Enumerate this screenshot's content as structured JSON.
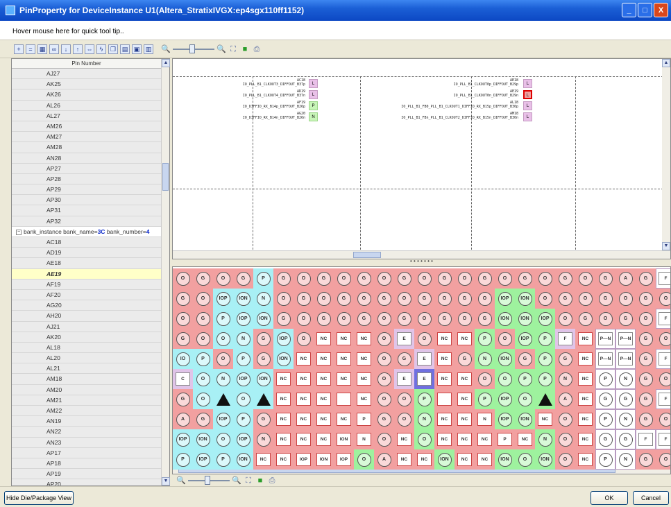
{
  "window": {
    "title": "PinProperty for DeviceInstance U1(Altera_StratixIVGX:ep4sgx110ff1152)",
    "minimize_glyph": "_",
    "maximize_glyph": "□",
    "close_glyph": "X"
  },
  "tooltip_hint": "Hover mouse here for quick tool tip..",
  "toolbar": {
    "icons": [
      "tb-icon-1",
      "tb-icon-2",
      "grid-icon",
      "binoculars-icon",
      "sort-az-icon",
      "sort-za-icon",
      "swap-icon",
      "lightning-icon",
      "copy-icon",
      "paste-icon",
      "export-icon",
      "layout-icon"
    ],
    "zoom_out_icon": "zoom-out-icon",
    "zoom_in_icon": "zoom-in-icon",
    "fit_icon": "fit-icon",
    "color_icon": "color-icon",
    "print_icon": "print-icon"
  },
  "pin_table": {
    "column_header": "Pin Number",
    "rows": [
      {
        "label": "AJ27"
      },
      {
        "label": "AK25"
      },
      {
        "label": "AK26"
      },
      {
        "label": "AL26"
      },
      {
        "label": "AL27"
      },
      {
        "label": "AM26"
      },
      {
        "label": "AM27"
      },
      {
        "label": "AM28"
      },
      {
        "label": "AN28"
      },
      {
        "label": "AP27"
      },
      {
        "label": "AP28"
      },
      {
        "label": "AP29"
      },
      {
        "label": "AP30"
      },
      {
        "label": "AP31"
      },
      {
        "label": "AP32"
      }
    ],
    "group": {
      "toggle": "−",
      "prefix": "bank_instance bank_name=",
      "bank_name": "3C",
      "middle": " bank_number=",
      "bank_number": "4"
    },
    "rows2": [
      {
        "label": "AC18"
      },
      {
        "label": "AD19"
      },
      {
        "label": "AE18"
      },
      {
        "label": "AE19",
        "selected": true
      },
      {
        "label": "AF19"
      },
      {
        "label": "AF20"
      },
      {
        "label": "AG20"
      },
      {
        "label": "AH20"
      },
      {
        "label": "AJ21"
      },
      {
        "label": "AK20"
      },
      {
        "label": "AL18"
      },
      {
        "label": "AL20"
      },
      {
        "label": "AL21"
      },
      {
        "label": "AM18"
      },
      {
        "label": "AM20"
      },
      {
        "label": "AM21"
      },
      {
        "label": "AM22"
      },
      {
        "label": "AN19"
      },
      {
        "label": "AN22"
      },
      {
        "label": "AN23"
      },
      {
        "label": "AP17"
      },
      {
        "label": "AP18"
      },
      {
        "label": "AP19"
      },
      {
        "label": "AP20"
      }
    ]
  },
  "die_labels": {
    "left": [
      {
        "pin": "AC18",
        "net": "IO_PLL_B1_CLKOUT3_DIFFOUT_B37p",
        "sym": "L"
      },
      {
        "pin": "AD19",
        "net": "IO_PLL_B1_CLKOUT4_DIFFOUT_B37n",
        "sym": "L"
      },
      {
        "pin": "AF19",
        "net": "IO_DIFFIO_RX_B14p_DIFFOUT_B26p",
        "sym": "P"
      },
      {
        "pin": "AG20",
        "net": "IO_DIFFIO_RX_B14n_DIFFOUT_B26n",
        "sym": "N"
      }
    ],
    "right": [
      {
        "pin": "AE18",
        "net": "IO_PLL_B1_CLKOUT0p_DIFFOUT_B29p",
        "sym": "L"
      },
      {
        "pin": "AE19",
        "net": "IO_PLL_B1_CLKOUT0n_DIFFOUT_B29n",
        "sym": "L"
      },
      {
        "pin": "AL18",
        "net": "IO_PLL_B1_FB0_PLL_B1_CLKOUT1_DIFFIO_RX_B15p_DIFFOUT_B30p",
        "sym": "L"
      },
      {
        "pin": "AM18",
        "net": "IO_PLL_B1_FBn_PLL_B1_CLKOUT2_DIFFIO_RX_B15n_DIFFOUT_B30n",
        "sym": "L"
      }
    ]
  },
  "splitter_dots": "• • • • • • •",
  "package_grid": {
    "rows": [
      [
        "pO",
        "pG",
        "pO",
        "pG",
        "cP",
        "pG",
        "pO",
        "pG",
        "pO",
        "pG",
        "pO",
        "pG",
        "pO",
        "pG",
        "pO",
        "pG",
        "pO",
        "pG",
        "pO",
        "pG",
        "pO",
        "pG",
        "pA",
        "pG",
        "wF"
      ],
      [
        "pG",
        "pO",
        "cIOP",
        "cION",
        "cN",
        "pO",
        "pG",
        "pO",
        "pG",
        "pO",
        "pG",
        "pO",
        "pG",
        "pO",
        "pG",
        "pO",
        "gIOP",
        "gION",
        "pO",
        "pG",
        "pO",
        "pG",
        "pO",
        "pG",
        "pO"
      ],
      [
        "pO",
        "pG",
        "cP",
        "cIOP",
        "cION",
        "pG",
        "pO",
        "pG",
        "pO",
        "pG",
        "pO",
        "pG",
        "pO",
        "pG",
        "pO",
        "pG",
        "gION",
        "gION",
        "gIOP",
        "pO",
        "pG",
        "pO",
        "pG",
        "pO",
        "wF"
      ],
      [
        "pG",
        "pO",
        "cO",
        "cN",
        "pG",
        "cIOP",
        "pO",
        "nNC",
        "nNC",
        "nNC",
        "pO",
        "lE",
        "pO",
        "nNC",
        "nNC",
        "gP",
        "pO",
        "gIOP",
        "gP",
        "lF",
        "nNC",
        "wPN",
        "wPN",
        "pG",
        "pO"
      ],
      [
        "cIO",
        "cP",
        "pO",
        "cP",
        "pG",
        "cION",
        "nNC",
        "nNC",
        "nNC",
        "nNC",
        "pO",
        "pG",
        "lE",
        "nNC",
        "pG",
        "gN",
        "gION",
        "pG",
        "gP",
        "pG",
        "nNC",
        "wPN",
        "wPN",
        "pG",
        "wF"
      ],
      [
        "lC",
        "cO",
        "cN",
        "cIOP",
        "cION",
        "nNC",
        "nNC",
        "nNC",
        "nNC",
        "nNC",
        "pO",
        "lE",
        "bE",
        "nNC",
        "nNC",
        "pO",
        "gO",
        "gP",
        "gP",
        "pN",
        "nNC",
        "wP",
        "wN",
        "pG",
        "pO"
      ],
      [
        "pG",
        "cO",
        "cS",
        "cO",
        "cS",
        "nNC",
        "nNC",
        "nNC",
        "nS",
        "nNC",
        "pO",
        "pO",
        "gP",
        "nS",
        "nNC",
        "gP",
        "gIOP",
        "gO",
        "gS",
        "pA",
        "nNC",
        "wG",
        "wG",
        "pG",
        "wF"
      ],
      [
        "pA",
        "pG",
        "cIOP",
        "cP",
        "pG",
        "nNC",
        "nNC",
        "nNC",
        "nNC",
        "nP",
        "pG",
        "pO",
        "gN",
        "nNC",
        "nNC",
        "nN",
        "gIOP",
        "gION",
        "nNC",
        "pO",
        "nNC",
        "wP",
        "wN",
        "pG",
        "pO"
      ],
      [
        "cIOP",
        "cION",
        "cO",
        "cIOP",
        "pN",
        "nNC",
        "nNC",
        "nNC",
        "nION",
        "nN",
        "pO",
        "nNC",
        "gO",
        "nNC",
        "nNC",
        "nNC",
        "nP",
        "nNC",
        "gN",
        "pO",
        "nNC",
        "wG",
        "wG",
        "wF",
        "wF"
      ],
      [
        "cP",
        "cIOP",
        "cP",
        "cION",
        "nNC",
        "nNC",
        "nIOP",
        "nION",
        "nIOP",
        "gO",
        "pA",
        "nNC",
        "nNC",
        "gION",
        "nNC",
        "nNC",
        "gION",
        "gO",
        "gION",
        "pO",
        "nNC",
        "wP",
        "wN",
        "pG",
        "pO"
      ]
    ],
    "symbols": {
      "O": "O",
      "G": "G",
      "P": "P",
      "N": "N",
      "IOP": "IOP",
      "ION": "ION",
      "NC": "NC",
      "IO": "IO",
      "C": "C",
      "E": "E",
      "F": "F",
      "A": "A",
      "S": "▲",
      "PN": "P—N"
    }
  },
  "status": {
    "hide_button": "Hide Die/Package View",
    "ok_button": "OK",
    "cancel_button": "Cancel"
  },
  "colors": {
    "pink": "#f2a0a0",
    "cyan": "#a8f0f5",
    "green": "#9ef29e",
    "lavender": "#e0c4e8",
    "violet": "#7070e0",
    "light_blue": "#cfe8f0",
    "white": "#ffffff"
  }
}
